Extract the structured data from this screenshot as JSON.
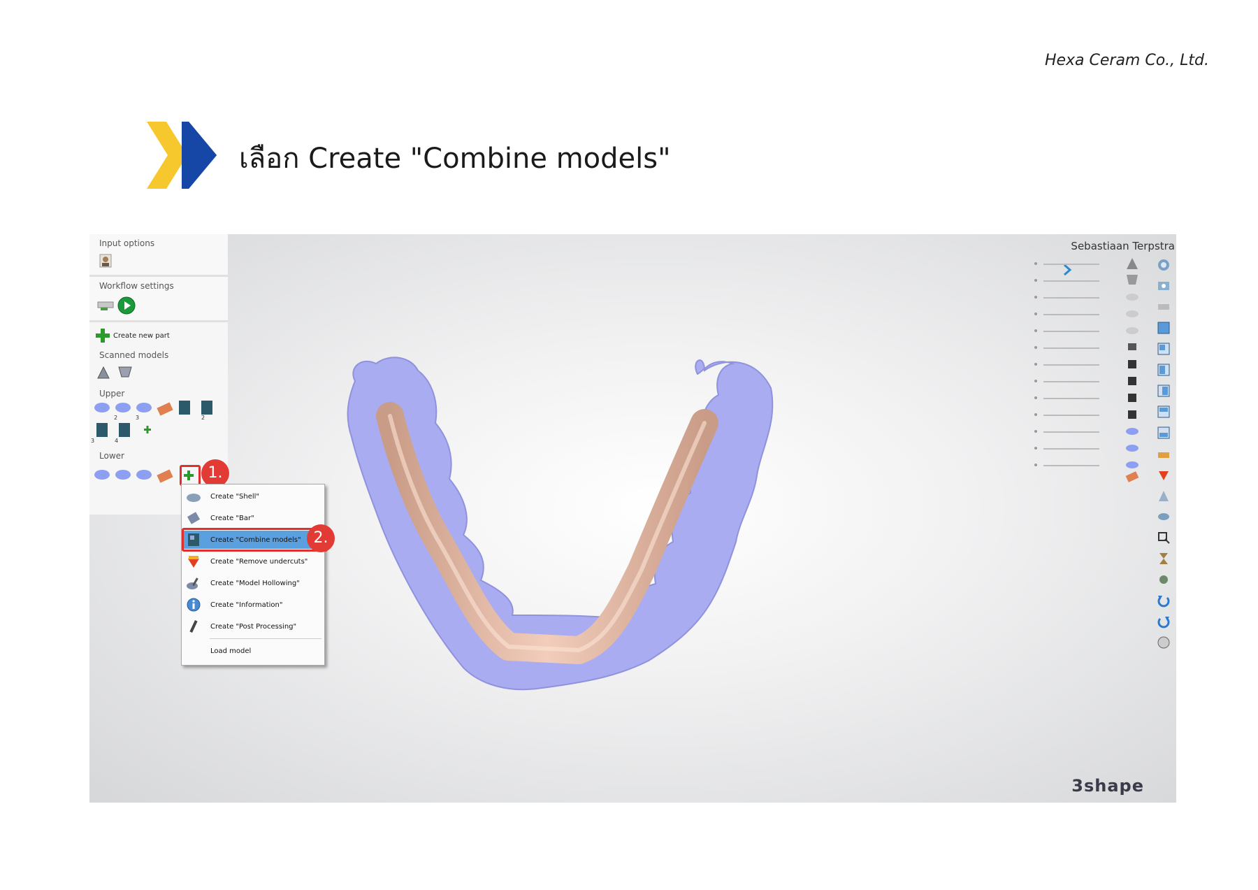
{
  "header": {
    "company": "Hexa Ceram Co., Ltd.",
    "title": "เลือก Create \"Combine models\""
  },
  "app": {
    "left_panel": {
      "input_options": "Input options",
      "workflow_settings": "Workflow settings",
      "create_new_part": "Create new part",
      "scanned_models": "Scanned models",
      "upper": "Upper",
      "lower": "Lower",
      "upper_badges": [
        "2",
        "3",
        "2",
        "3",
        "4"
      ]
    },
    "menu": {
      "items": [
        {
          "label": "Create \"Shell\"",
          "icon": "shell-icon"
        },
        {
          "label": "Create \"Bar\"",
          "icon": "bar-icon"
        },
        {
          "label": "Create \"Combine models\"",
          "icon": "combine-models-icon"
        },
        {
          "label": "Create \"Remove undercuts\"",
          "icon": "remove-undercuts-icon"
        },
        {
          "label": "Create \"Model Hollowing\"",
          "icon": "model-hollowing-icon"
        },
        {
          "label": "Create \"Information\"",
          "icon": "information-icon"
        },
        {
          "label": "Create \"Post Processing\"",
          "icon": "post-processing-icon"
        }
      ],
      "load_model": "Load model",
      "selected_index": 2
    },
    "callouts": [
      "1.",
      "2."
    ],
    "user_name": "Sebastiaan Terpstra",
    "logo": "3shape",
    "colors": {
      "model": "#a9acf0",
      "bar": "#e6bca8",
      "callout": "#e23b36",
      "selection": "#5aa0de",
      "arrow_yellow": "#f7c72e",
      "arrow_blue": "#1747a6"
    }
  }
}
